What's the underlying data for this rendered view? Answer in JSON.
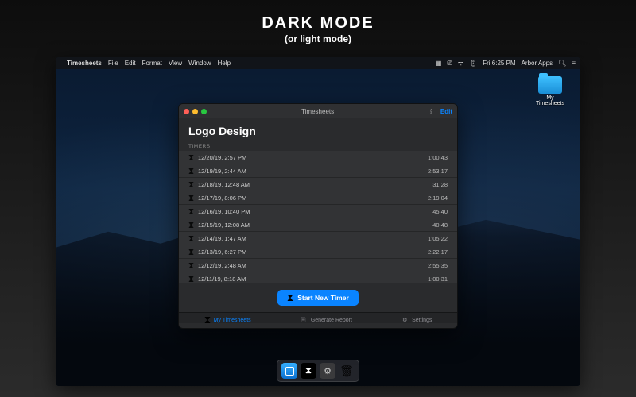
{
  "hero": {
    "title": "DARK MODE",
    "subtitle": "(or light mode)"
  },
  "menubar": {
    "app": "Timesheets",
    "items": [
      "File",
      "Edit",
      "Format",
      "View",
      "Window",
      "Help"
    ],
    "status_time": "Fri 6:25 PM",
    "status_user": "Arbor Apps"
  },
  "desktop_folder": {
    "label": "My Timesheets"
  },
  "window": {
    "title": "Timesheets",
    "edit_label": "Edit",
    "project_title": "Logo Design",
    "section_label": "TIMERS",
    "rows": [
      {
        "date": "12/20/19, 2:57 PM",
        "duration": "1:00:43"
      },
      {
        "date": "12/19/19, 2:44 AM",
        "duration": "2:53:17"
      },
      {
        "date": "12/18/19, 12:48 AM",
        "duration": "31:28"
      },
      {
        "date": "12/17/19, 8:06 PM",
        "duration": "2:19:04"
      },
      {
        "date": "12/16/19, 10:40 PM",
        "duration": "45:40"
      },
      {
        "date": "12/15/19, 12:08 AM",
        "duration": "40:48"
      },
      {
        "date": "12/14/19, 1:47 AM",
        "duration": "1:05:22"
      },
      {
        "date": "12/13/19, 6:27 PM",
        "duration": "2:22:17"
      },
      {
        "date": "12/12/19, 2:48 AM",
        "duration": "2:55:35"
      },
      {
        "date": "12/11/19, 8:18 AM",
        "duration": "1:00:31"
      }
    ],
    "primary_button": "Start New Timer",
    "tabs": [
      {
        "id": "my-timesheets",
        "label": "My Timesheets",
        "icon": "hourglass-icon"
      },
      {
        "id": "generate-report",
        "label": "Generate Report",
        "icon": "document-icon"
      },
      {
        "id": "settings",
        "label": "Settings",
        "icon": "gear-icon"
      }
    ],
    "active_tab": "my-timesheets"
  }
}
